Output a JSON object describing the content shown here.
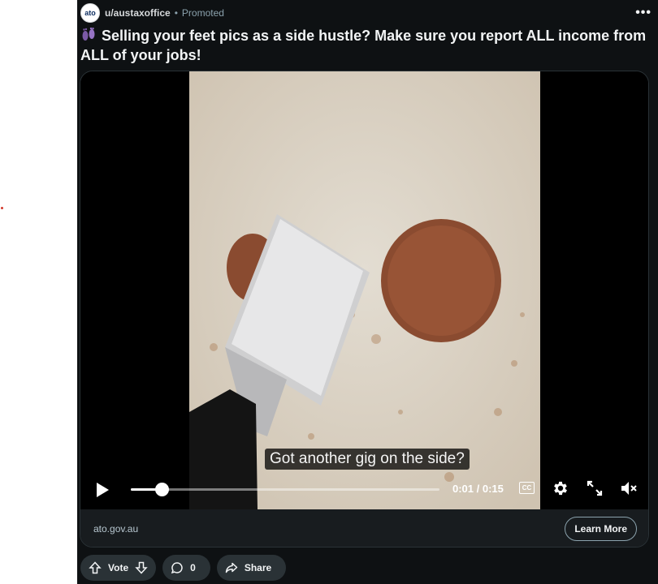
{
  "post": {
    "avatar_text": "ato",
    "username": "u/austaxoffice",
    "separator": "•",
    "promoted": "Promoted",
    "more": "•••",
    "title": "Selling your feet pics as a side hustle? Make sure you report ALL income from ALL of your jobs!"
  },
  "video": {
    "caption": "Got another gig on the side?",
    "time": "0:01 / 0:15",
    "cc": "CC",
    "progress_fraction": 0.1
  },
  "footer": {
    "domain": "ato.gov.au",
    "cta": "Learn More"
  },
  "actions": {
    "vote": "Vote",
    "comments": "0",
    "share": "Share"
  }
}
